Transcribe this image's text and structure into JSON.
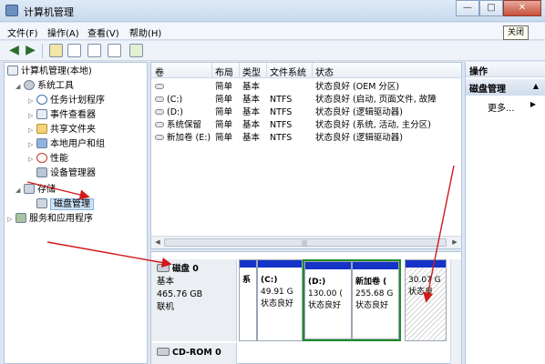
{
  "window": {
    "title": "计算机管理"
  },
  "window_buttons": {
    "minimize": "—",
    "maximize": "□",
    "close": "✕"
  },
  "tooltip": {
    "close": "关闭"
  },
  "menu": {
    "items": [
      "文件(F)",
      "操作(A)",
      "查看(V)",
      "帮助(H)"
    ]
  },
  "tree": {
    "root": "计算机管理(本地)",
    "system_tools": "系统工具",
    "task_scheduler": "任务计划程序",
    "event_viewer": "事件查看器",
    "shared_folders": "共享文件夹",
    "local_users": "本地用户和组",
    "performance": "性能",
    "device_manager": "设备管理器",
    "storage": "存储",
    "disk_management": "磁盘管理",
    "services": "服务和应用程序"
  },
  "list": {
    "columns": [
      "卷",
      "布局",
      "类型",
      "文件系统",
      "状态"
    ],
    "rows": [
      {
        "volume": "",
        "layout": "简单",
        "type": "基本",
        "fs": "",
        "status": "状态良好 (OEM 分区)"
      },
      {
        "volume": "(C:)",
        "layout": "简单",
        "type": "基本",
        "fs": "NTFS",
        "status": "状态良好 (启动, 页面文件, 故障"
      },
      {
        "volume": "(D:)",
        "layout": "简单",
        "type": "基本",
        "fs": "NTFS",
        "status": "状态良好 (逻辑驱动器)"
      },
      {
        "volume": "系统保留",
        "layout": "简单",
        "type": "基本",
        "fs": "NTFS",
        "status": "状态良好 (系统, 活动, 主分区)"
      },
      {
        "volume": "新加卷 (E:)",
        "layout": "简单",
        "type": "基本",
        "fs": "NTFS",
        "status": "状态良好 (逻辑驱动器)"
      }
    ]
  },
  "disk0": {
    "title": "磁盘 0",
    "type": "基本",
    "size": "465.76 GB",
    "status": "联机",
    "partitions": [
      {
        "name": "系",
        "size": "",
        "status": ""
      },
      {
        "name": "(C:)",
        "size": "49.91 G",
        "status": "状态良好"
      },
      {
        "name": "(D:)",
        "size": "130.00 (",
        "status": "状态良好"
      },
      {
        "name": "新加卷 (",
        "size": "255.68 G",
        "status": "状态良好"
      },
      {
        "name": "",
        "size": "30.07 G",
        "status": "状态良"
      }
    ]
  },
  "cdrom": {
    "title": "CD-ROM 0"
  },
  "actions": {
    "header": "操作",
    "section": "磁盘管理",
    "more": "更多..."
  },
  "colors": {
    "partition_bar": "#1633c7",
    "selection_border": "#1f8a2a",
    "annotation_arrow": "#d11a1a"
  }
}
